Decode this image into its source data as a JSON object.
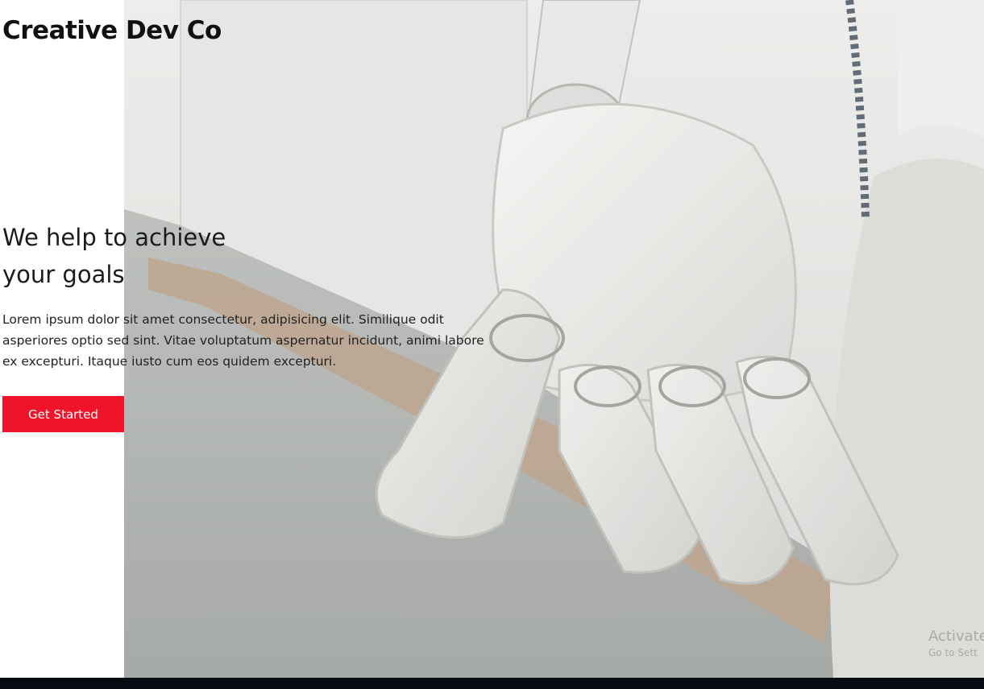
{
  "brand": {
    "name": "Creative Dev Co"
  },
  "hero": {
    "headline_line1": "We help to achieve",
    "headline_line2": "your goals",
    "body": "Lorem ipsum dolor sit amet consectetur, adipisicing elit. Similique odit asperiores optio sed sint. Vitae voluptatum aspernatur incidunt, animi labore ex excepturi. Itaque iusto cum eos quidem excepturi.",
    "cta_label": "Get Started",
    "image_alt": "robot-hand-image"
  },
  "watermark": {
    "line1": "Activate",
    "line2": "Go to Sett"
  },
  "colors": {
    "accent": "#f0142a",
    "text": "#111111",
    "background": "#ffffff",
    "bottom_bar": "#050b10"
  }
}
